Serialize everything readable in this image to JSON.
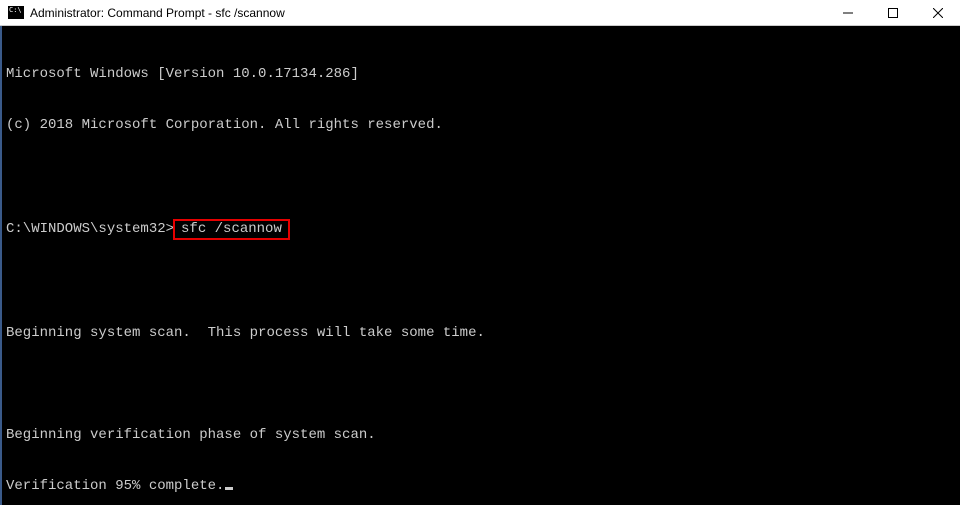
{
  "titlebar": {
    "title": "Administrator: Command Prompt - sfc  /scannow"
  },
  "console": {
    "line1": "Microsoft Windows [Version 10.0.17134.286]",
    "line2": "(c) 2018 Microsoft Corporation. All rights reserved.",
    "prompt": "C:\\WINDOWS\\system32>",
    "command": "sfc /scannow",
    "line3": "Beginning system scan.  This process will take some time.",
    "line4": "Beginning verification phase of system scan.",
    "line5": "Verification 95% complete."
  }
}
